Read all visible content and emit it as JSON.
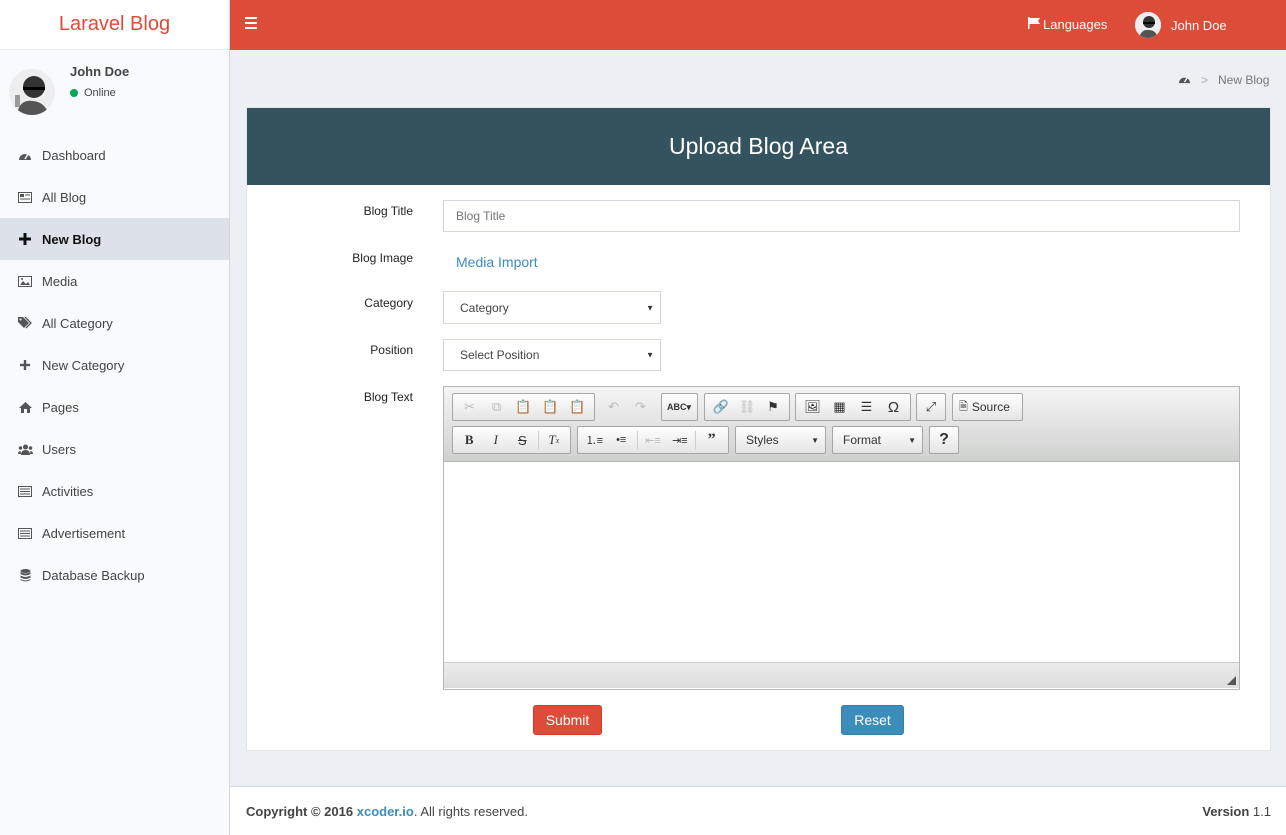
{
  "app": {
    "logo": "Laravel Blog"
  },
  "user": {
    "name": "John Doe",
    "status": "Online"
  },
  "sidebar": {
    "items": [
      {
        "label": "Dashboard",
        "icon": "dashboard-icon"
      },
      {
        "label": "All Blog",
        "icon": "newspaper-icon"
      },
      {
        "label": "New Blog",
        "icon": "plus-icon",
        "active": true
      },
      {
        "label": "Media",
        "icon": "image-icon"
      },
      {
        "label": "All Category",
        "icon": "tags-icon"
      },
      {
        "label": "New Category",
        "icon": "plus-icon"
      },
      {
        "label": "Pages",
        "icon": "home-icon"
      },
      {
        "label": "Users",
        "icon": "users-icon"
      },
      {
        "label": "Activities",
        "icon": "list-icon"
      },
      {
        "label": "Advertisement",
        "icon": "list-icon"
      },
      {
        "label": "Database Backup",
        "icon": "database-icon"
      }
    ]
  },
  "header": {
    "languages": "Languages",
    "user_name": "John Doe"
  },
  "breadcrumb": {
    "separator": ">",
    "current": "New Blog"
  },
  "form": {
    "title": "Upload Blog Area",
    "blog_title_label": "Blog Title",
    "blog_title_placeholder": "Blog Title",
    "blog_image_label": "Blog Image",
    "media_import": "Media Import",
    "category_label": "Category",
    "category_value": "Category",
    "position_label": "Position",
    "position_value": "Select Position",
    "blog_text_label": "Blog Text",
    "submit": "Submit",
    "reset": "Reset"
  },
  "editor": {
    "source_label": "Source",
    "styles_label": "Styles",
    "format_label": "Format"
  },
  "footer": {
    "copyright_prefix": "Copyright © 2016",
    "link": "xcoder.io",
    "suffix": ". All rights reserved.",
    "version_label": "Version",
    "version": "1.1"
  },
  "colors": {
    "brand": "#dd4b39",
    "box_header": "#34535f",
    "link": "#3c8dbc"
  }
}
